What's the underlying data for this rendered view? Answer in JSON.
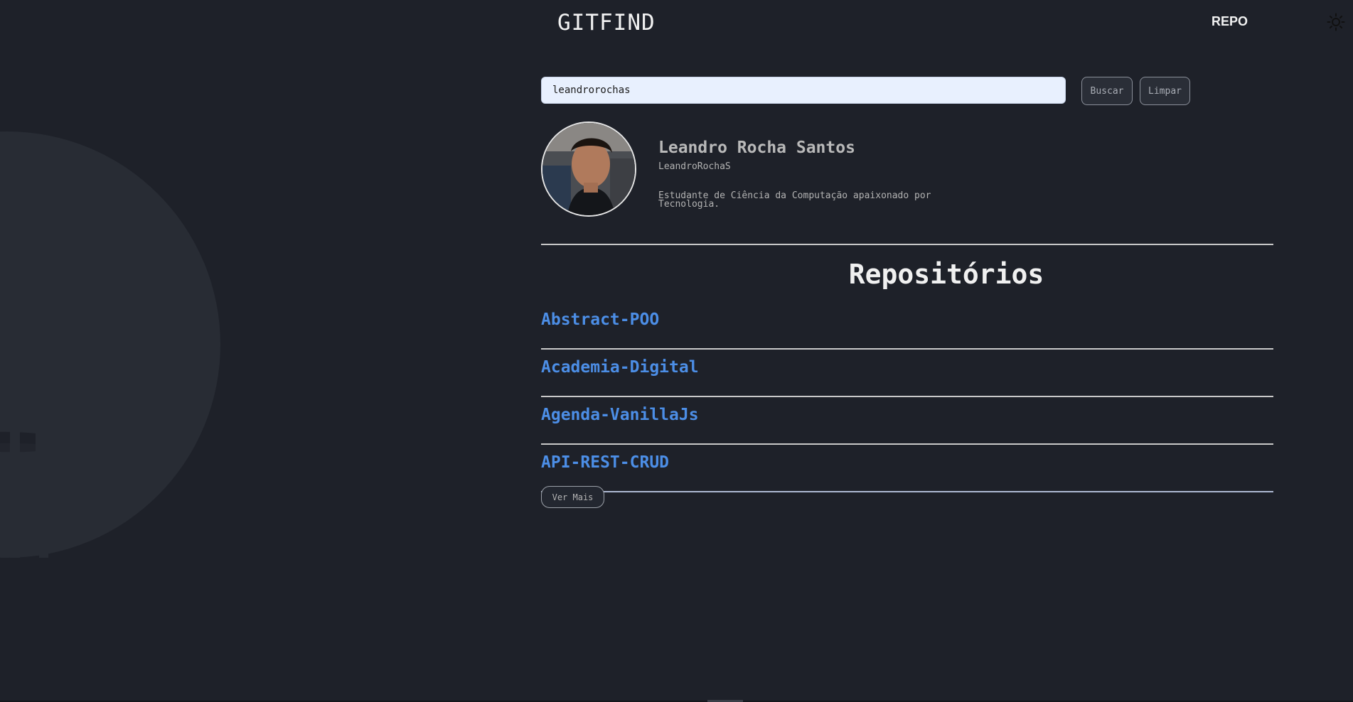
{
  "header": {
    "brand": "GITFIND",
    "nav_repo": "REPO",
    "theme_icon": "sun-icon"
  },
  "search": {
    "value": "leandrorochas",
    "placeholder": "",
    "buscar_label": "Buscar",
    "limpar_label": "Limpar"
  },
  "profile": {
    "name": "Leandro Rocha Santos",
    "login": "LeandroRochaS",
    "bio": "Estudante de Ciência da Computação apaixonado por Tecnologia."
  },
  "repositories": {
    "title": "Repositórios",
    "items": [
      {
        "name": "Abstract-POO"
      },
      {
        "name": "Academia-Digital"
      },
      {
        "name": "Agenda-VanillaJs"
      },
      {
        "name": "API-REST-CRUD"
      }
    ],
    "more_label": "Ver Mais"
  },
  "colors": {
    "background": "#1e2129",
    "link": "#4c8ee6",
    "input_bg": "#e8f0fe"
  }
}
